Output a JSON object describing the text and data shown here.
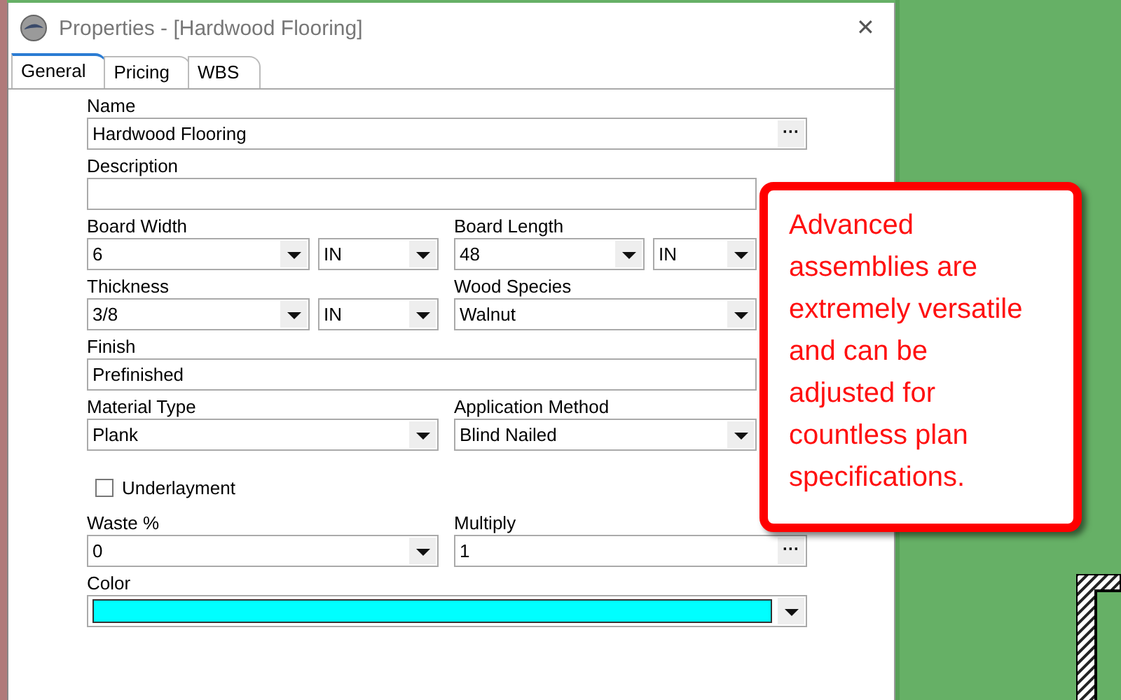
{
  "window": {
    "title": "Properties - [Hardwood Flooring]",
    "close": "✕"
  },
  "tabs": [
    {
      "label": "General",
      "selected": true
    },
    {
      "label": "Pricing",
      "selected": false
    },
    {
      "label": "WBS",
      "selected": false
    }
  ],
  "rows": [
    [
      {
        "kind": "ellipsis",
        "label": "Name",
        "value": "Hardwood Flooring",
        "button": "···"
      }
    ],
    [
      {
        "kind": "text",
        "label": "Description"
      }
    ],
    [
      {
        "kind": "combo",
        "label": "Board Width",
        "value": "6",
        "unit": "IN"
      },
      {
        "kind": "combo",
        "label": "Board Length",
        "value": "48",
        "unit": "IN"
      }
    ],
    [
      {
        "kind": "combo",
        "label": "Thickness",
        "value": "3/8",
        "unit": "IN"
      },
      {
        "kind": "combo",
        "label": "Wood Species",
        "value": "Walnut"
      }
    ],
    [
      {
        "kind": "text",
        "label": "Finish",
        "value": "Prefinished"
      }
    ],
    [
      {
        "kind": "combo",
        "label": "Material Type",
        "value": "Plank"
      },
      {
        "kind": "combo",
        "label": "Application Method",
        "value": "Blind Nailed"
      }
    ],
    [
      {
        "kind": "checkbox",
        "label": "Underlayment",
        "checked": false
      }
    ],
    [
      {
        "kind": "combo",
        "label": "Waste %",
        "value": "0"
      },
      {
        "kind": "ellipsis",
        "label": "Multiply",
        "value": "1",
        "button": "···"
      }
    ],
    [
      {
        "kind": "color",
        "label": "Color",
        "color": "#00ffff"
      }
    ]
  ],
  "callout": {
    "text": "Advanced assemblies are extremely versatile and can be adjusted for countless plan specifications."
  }
}
